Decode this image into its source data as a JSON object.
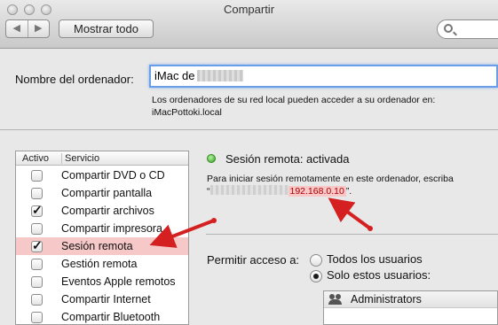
{
  "window": {
    "title": "Compartir"
  },
  "toolbar": {
    "back_glyph": "◀",
    "forward_glyph": "▶",
    "show_all_label": "Mostrar todo",
    "search_icon": "search-icon"
  },
  "computer_name": {
    "label": "Nombre del ordenador:",
    "value": "iMac de",
    "help_line1": "Los ordenadores de su red local pueden acceder a su ordenador en:",
    "help_line2": "iMacPottoki.local"
  },
  "services": {
    "col_active": "Activo",
    "col_service": "Servicio",
    "items": [
      {
        "label": "Compartir DVD o CD",
        "checked": false
      },
      {
        "label": "Compartir pantalla",
        "checked": false
      },
      {
        "label": "Compartir archivos",
        "checked": true
      },
      {
        "label": "Compartir impresora",
        "checked": false
      },
      {
        "label": "Sesión remota",
        "checked": true,
        "selected": true
      },
      {
        "label": "Gestión remota",
        "checked": false
      },
      {
        "label": "Eventos Apple remotos",
        "checked": false
      },
      {
        "label": "Compartir Internet",
        "checked": false
      },
      {
        "label": "Compartir Bluetooth",
        "checked": false
      }
    ]
  },
  "status": {
    "text": "Sesión remota: activada",
    "color": "#36a41e",
    "info_line1": "Para iniciar sesión remotamente en este ordenador, escriba",
    "info_open_quote": "“",
    "ip": "192.168.0.10",
    "info_close": "”."
  },
  "access": {
    "label": "Permitir acceso a:",
    "option_all": "Todos los usuarios",
    "option_only": "Solo estos usuarios:",
    "selected": "only"
  },
  "users": {
    "items": [
      "Administrators"
    ]
  },
  "annotation_color": "#d42020"
}
